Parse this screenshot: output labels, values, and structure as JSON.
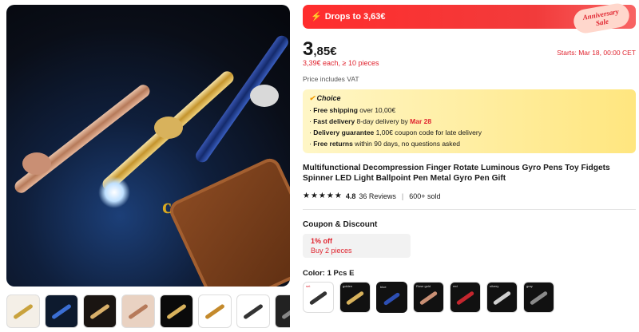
{
  "banner": {
    "bolt_icon": "lightning-bolt-icon",
    "drop_text": "Drops to 3,63€",
    "badge_line1": "Anniversary",
    "badge_line2": "Sale"
  },
  "price": {
    "integer": "3",
    "cents": ",85€",
    "bulk_note": "3,39€ each, ≥ 10 pieces",
    "starts_text": "Starts: Mar 18, 00:00 CET",
    "vat_note": "Price includes VAT"
  },
  "choice": {
    "label": "Choice",
    "items": [
      {
        "bold": "Free shipping",
        "text": " over 10,00€"
      },
      {
        "bold": "Fast delivery",
        "text": " 8-day delivery by ",
        "highlight": "Mar 28"
      },
      {
        "bold": "Delivery guarantee",
        "text": " 1,00€ coupon code for late delivery"
      },
      {
        "bold": "Free returns",
        "text": " within 90 days, no questions asked"
      }
    ]
  },
  "product": {
    "title": "Multifunctional Decompression Finger Rotate Luminous Gyro Pens Toy Fidgets Spinner LED Light Ballpoint Pen Metal Gyro Pen Gift",
    "stars": "★★★★★",
    "rating": "4.8",
    "reviews": "36 Reviews",
    "sold": "600+ sold"
  },
  "coupon": {
    "title": "Coupon & Discount",
    "discount": "1% off",
    "condition": "Buy 2 pieces"
  },
  "color": {
    "label": "Color: 1 Pcs E",
    "swatches": [
      "set",
      "golden",
      "blue",
      "Rose gold",
      "red",
      "silvery",
      "gray"
    ]
  },
  "colors": {
    "accent_red": "#e0242f",
    "banner_red": "#ff2d2d",
    "choice_yellow": "#ffe67f"
  }
}
